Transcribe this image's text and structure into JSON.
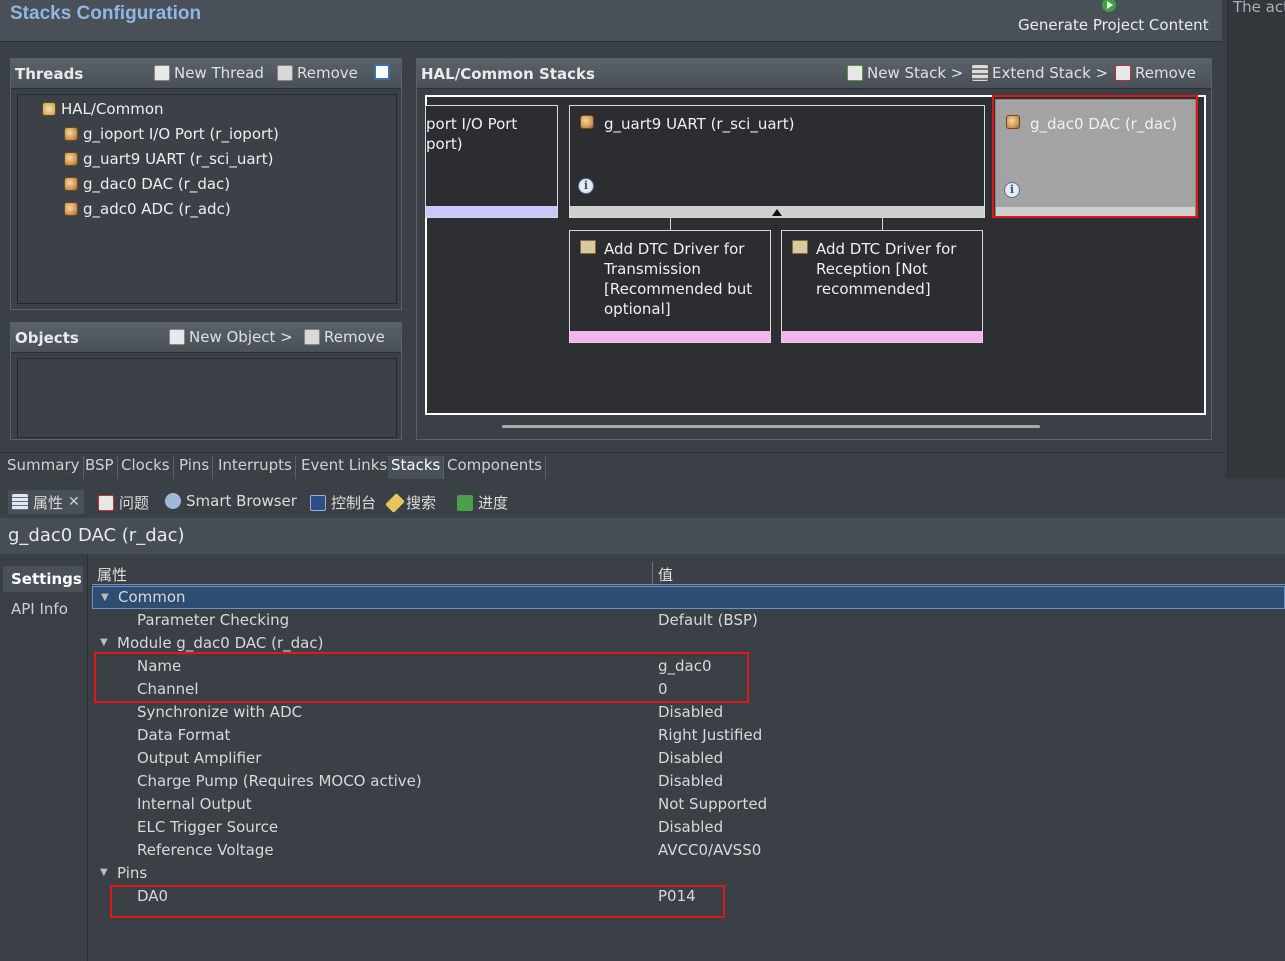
{
  "editor": {
    "title": "Stacks Configuration",
    "generate_label": "Generate Project Content",
    "right_partial_text": "The act"
  },
  "threads": {
    "title": "Threads",
    "new_thread": "New Thread",
    "remove": "Remove",
    "root": "HAL/Common",
    "items": [
      "g_ioport I/O Port (r_ioport)",
      "g_uart9 UART (r_sci_uart)",
      "g_dac0 DAC (r_dac)",
      "g_adc0 ADC (r_adc)"
    ]
  },
  "objects": {
    "title": "Objects",
    "new_object": "New Object >",
    "remove": "Remove"
  },
  "stacks": {
    "title": "HAL/Common Stacks",
    "new_stack": "New Stack >",
    "extend_stack": "Extend Stack >",
    "remove": "Remove",
    "cards": {
      "ioport_line1": "port I/O Port",
      "ioport_line2": "port)",
      "uart": "g_uart9 UART (r_sci_uart)",
      "dac": "g_dac0 DAC (r_dac)",
      "dtc_tx": "Add DTC Driver for Transmission [Recommended but optional]",
      "dtc_rx": "Add DTC Driver for Reception [Not recommended]"
    }
  },
  "tabs": [
    "Summary",
    "BSP",
    "Clocks",
    "Pins",
    "Interrupts",
    "Event Links",
    "Stacks",
    "Components"
  ],
  "active_tab": "Stacks",
  "views": {
    "properties": "属性",
    "problems": "问题",
    "smart_browser": "Smart Browser",
    "console": "控制台",
    "search": "搜索",
    "progress": "进度"
  },
  "properties": {
    "title": "g_dac0 DAC (r_dac)",
    "side_tabs": [
      "Settings",
      "API Info"
    ],
    "col_property": "属性",
    "col_value": "值",
    "groups": {
      "common": "Common",
      "module": "Module g_dac0 DAC (r_dac)",
      "pins": "Pins"
    },
    "rows": [
      {
        "k": "Parameter Checking",
        "v": "Default (BSP)"
      },
      {
        "k": "Name",
        "v": "g_dac0"
      },
      {
        "k": "Channel",
        "v": "0"
      },
      {
        "k": "Synchronize with ADC",
        "v": "Disabled"
      },
      {
        "k": "Data Format",
        "v": "Right Justified"
      },
      {
        "k": "Output Amplifier",
        "v": "Disabled"
      },
      {
        "k": "Charge Pump (Requires MOCO active)",
        "v": "Disabled"
      },
      {
        "k": "Internal Output",
        "v": "Not Supported"
      },
      {
        "k": "ELC Trigger Source",
        "v": "Disabled"
      },
      {
        "k": "Reference Voltage",
        "v": "AVCC0/AVSS0"
      },
      {
        "k": "DA0",
        "v": "P014"
      }
    ]
  },
  "colors": {
    "accent_title": "#8fb6e6",
    "highlight_red": "#e01818",
    "bar_lavender": "#c8c8ff",
    "bar_pink": "#f4b4f0"
  }
}
